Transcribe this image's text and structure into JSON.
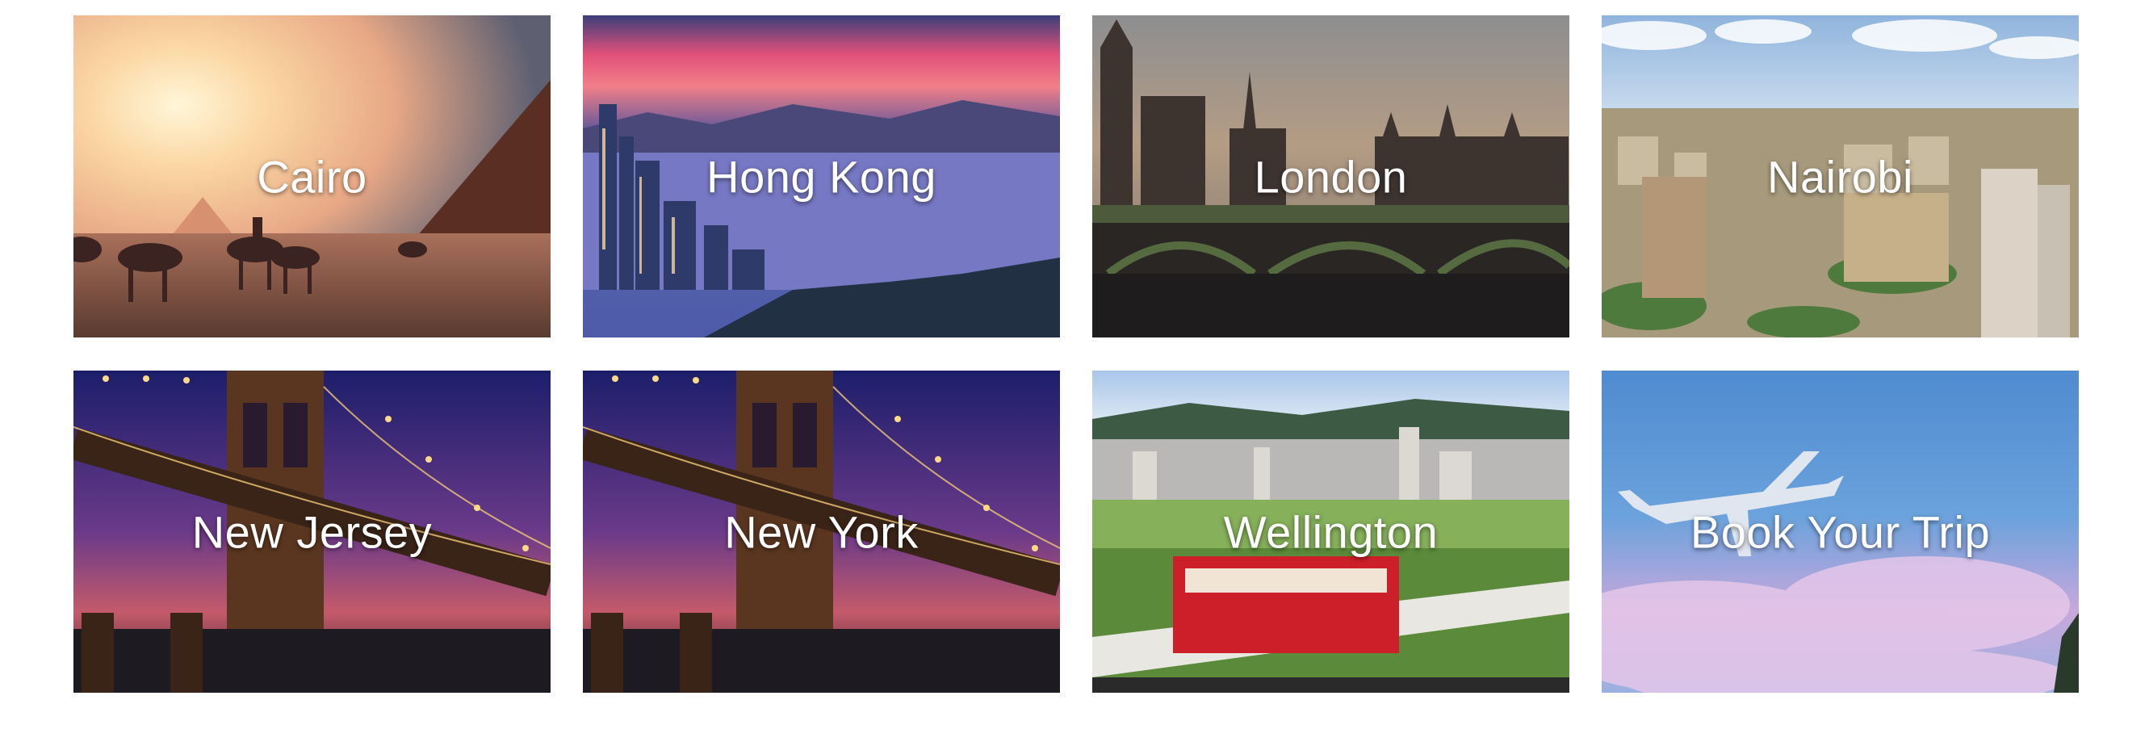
{
  "destinations": [
    {
      "label": "Cairo",
      "image": "cairo-pyramids-camels-sunset"
    },
    {
      "label": "Hong Kong",
      "image": "hong-kong-harbor-sunset"
    },
    {
      "label": "London",
      "image": "london-westminster-bridge"
    },
    {
      "label": "Nairobi",
      "image": "nairobi-city-aerial"
    },
    {
      "label": "New Jersey",
      "image": "brooklyn-bridge-night"
    },
    {
      "label": "New York",
      "image": "brooklyn-bridge-night"
    },
    {
      "label": "Wellington",
      "image": "wellington-red-cable-car"
    },
    {
      "label": "Book Your Trip",
      "image": "airplane-in-sky"
    }
  ]
}
